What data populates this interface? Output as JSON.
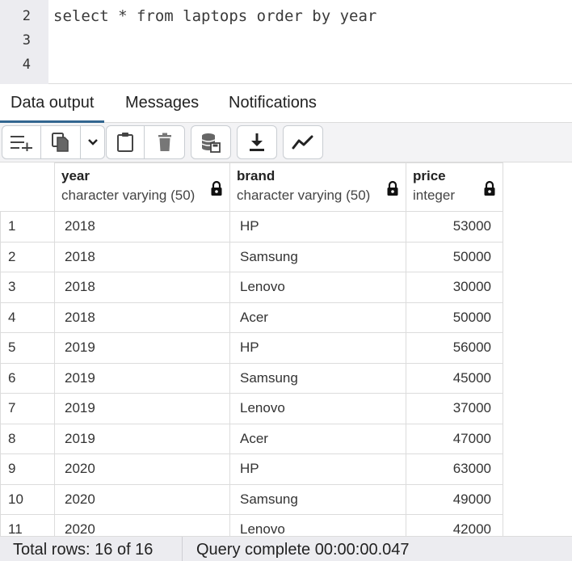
{
  "editor": {
    "lines": [
      {
        "number": "2",
        "code": "select * from laptops order by year"
      },
      {
        "number": "3",
        "code": ""
      },
      {
        "number": "4",
        "code": ""
      }
    ]
  },
  "tabs": [
    {
      "label": "Data output",
      "active": true
    },
    {
      "label": "Messages",
      "active": false
    },
    {
      "label": "Notifications",
      "active": false
    }
  ],
  "toolbar": {
    "icons": [
      "add-row-icon",
      "copy-icon",
      "chevron-down-icon",
      "paste-icon",
      "delete-icon",
      "save-data-icon",
      "download-icon",
      "graph-icon"
    ]
  },
  "grid": {
    "columns": [
      {
        "name": "year",
        "type": "character varying (50)"
      },
      {
        "name": "brand",
        "type": "character varying (50)"
      },
      {
        "name": "price",
        "type": "integer"
      }
    ],
    "rows": [
      {
        "n": "1",
        "year": "2018",
        "brand": "HP",
        "price": "53000"
      },
      {
        "n": "2",
        "year": "2018",
        "brand": "Samsung",
        "price": "50000"
      },
      {
        "n": "3",
        "year": "2018",
        "brand": "Lenovo",
        "price": "30000"
      },
      {
        "n": "4",
        "year": "2018",
        "brand": "Acer",
        "price": "50000"
      },
      {
        "n": "5",
        "year": "2019",
        "brand": "HP",
        "price": "56000"
      },
      {
        "n": "6",
        "year": "2019",
        "brand": "Samsung",
        "price": "45000"
      },
      {
        "n": "7",
        "year": "2019",
        "brand": "Lenovo",
        "price": "37000"
      },
      {
        "n": "8",
        "year": "2019",
        "brand": "Acer",
        "price": "47000"
      },
      {
        "n": "9",
        "year": "2020",
        "brand": "HP",
        "price": "63000"
      },
      {
        "n": "10",
        "year": "2020",
        "brand": "Samsung",
        "price": "49000"
      },
      {
        "n": "11",
        "year": "2020",
        "brand": "Lenovo",
        "price": "42000"
      }
    ]
  },
  "status": {
    "total_rows": "Total rows: 16 of 16",
    "query": "Query complete 00:00:00.047"
  },
  "colors": {
    "accent": "#326690",
    "gutter": "#ececf0",
    "toolbar": "#f3f3f5"
  }
}
